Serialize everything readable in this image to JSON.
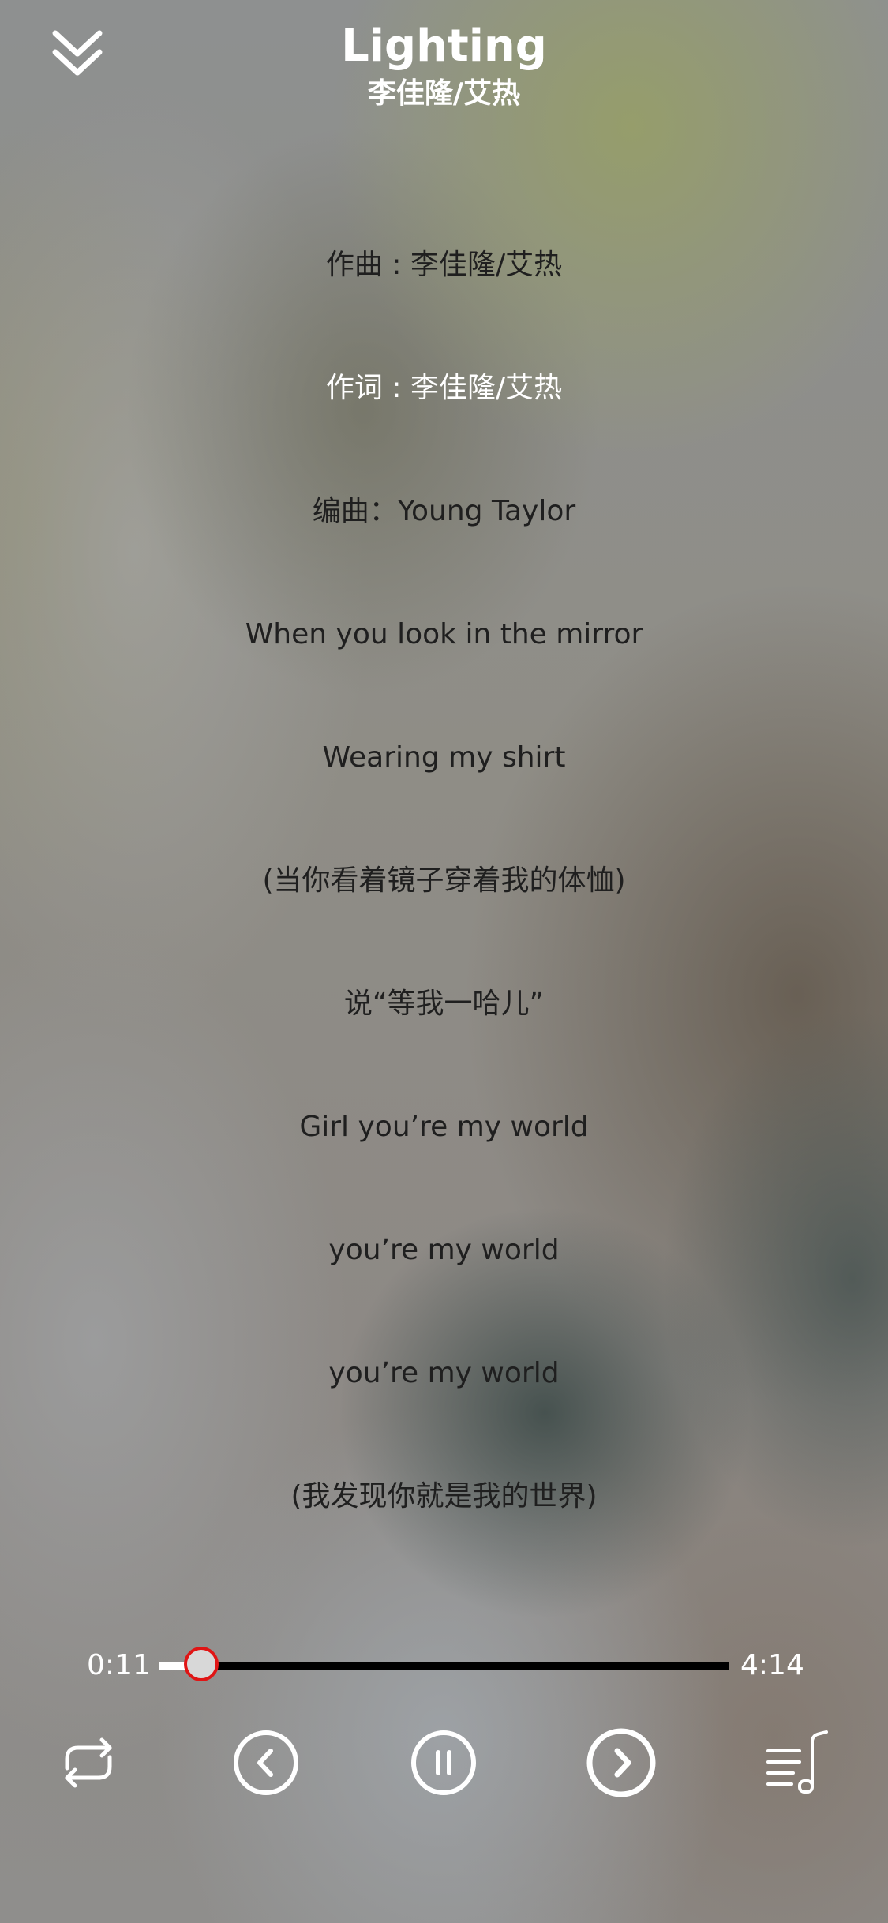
{
  "song": {
    "title": "Lighting",
    "artist": "李佳隆/艾热"
  },
  "lyrics": [
    {
      "text": "作曲 : 李佳隆/艾热",
      "active": false
    },
    {
      "text": "作词 : 李佳隆/艾热",
      "active": true
    },
    {
      "text": "编曲：Young Taylor",
      "active": false
    },
    {
      "text": "When you look in the mirror",
      "active": false
    },
    {
      "text": "Wearing my shirt",
      "active": false
    },
    {
      "text": "(当你看着镜子穿着我的体恤)",
      "active": false
    },
    {
      "text": "说“等我一哈儿”",
      "active": false
    },
    {
      "text": "Girl you’re my world",
      "active": false
    },
    {
      "text": "you’re my world",
      "active": false
    },
    {
      "text": "you’re my world",
      "active": false
    },
    {
      "text": "(我发现你就是我的世界)",
      "active": false
    }
  ],
  "player": {
    "current_time": "0:11",
    "total_time": "4:14",
    "progress_fraction": 0.073
  },
  "controls": {
    "collapse_icon": "double-chevron-down-icon",
    "repeat_icon": "repeat-icon",
    "prev_icon": "previous-circle-icon",
    "pause_icon": "pause-circle-icon",
    "next_icon": "next-circle-icon",
    "playlist_icon": "playlist-music-icon"
  },
  "colors": {
    "lyric_default": "#1f1f1f",
    "lyric_active": "#ffffff",
    "progress_thumb_border": "#e01515",
    "progress_track": "#000000",
    "progress_played": "#ffffff"
  }
}
